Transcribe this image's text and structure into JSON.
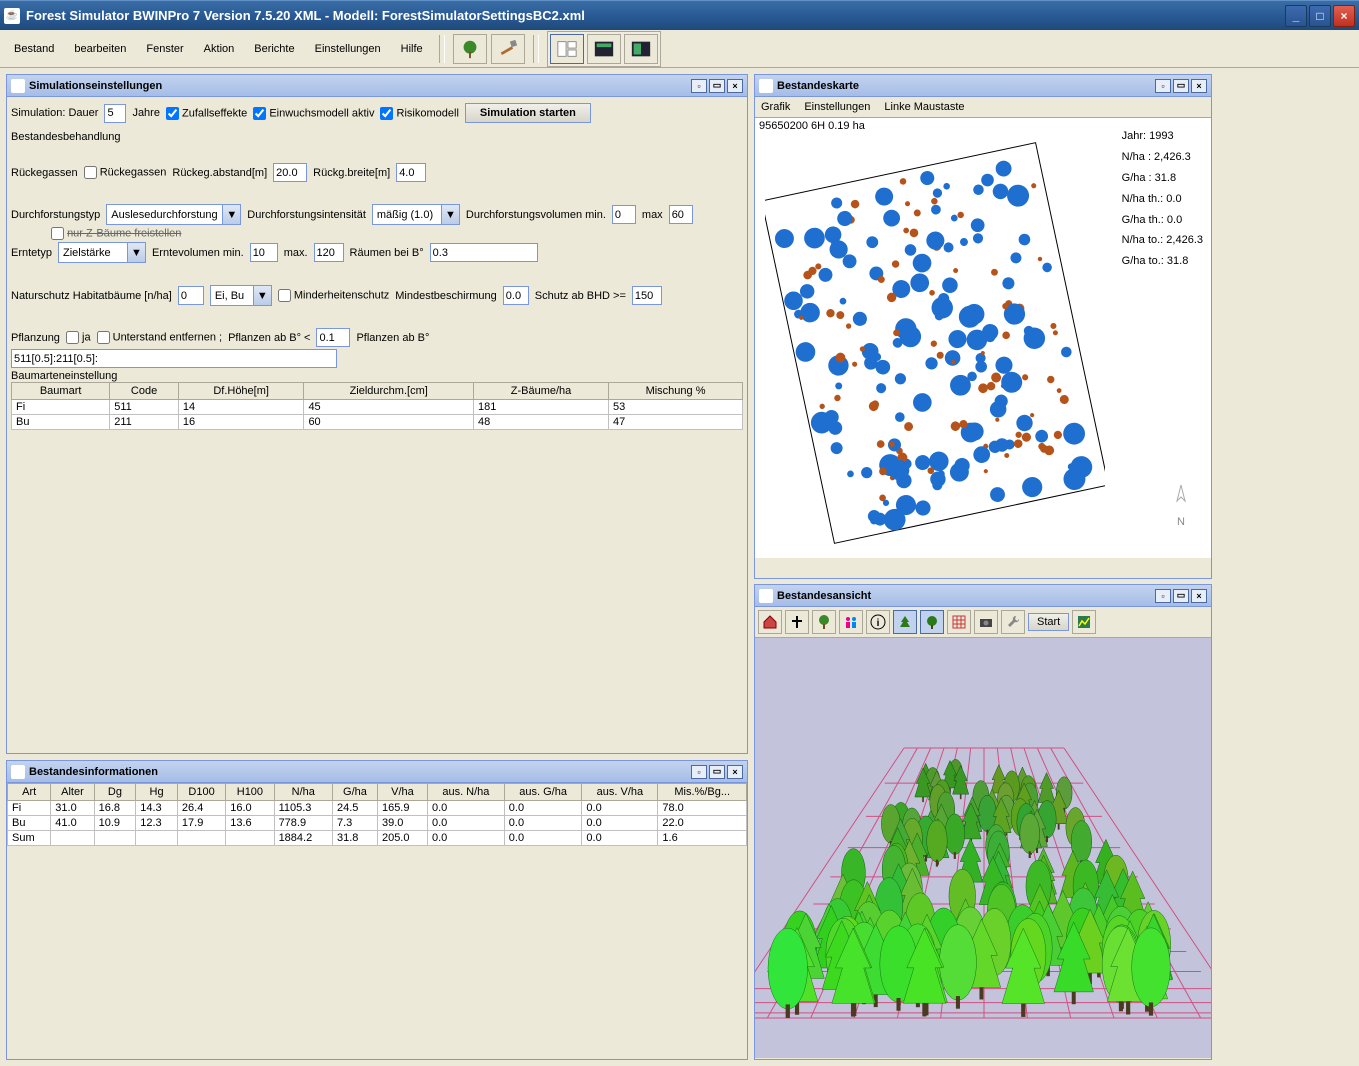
{
  "title": "Forest Simulator BWINPro 7 Version 7.5.20 XML - Modell: ForestSimulatorSettingsBC2.xml",
  "menu": {
    "bestand": "Bestand",
    "bearbeiten": "bearbeiten",
    "fenster": "Fenster",
    "aktion": "Aktion",
    "berichte": "Berichte",
    "einstellungen": "Einstellungen",
    "hilfe": "Hilfe"
  },
  "panel_sim": {
    "title": "Simulationseinstellungen",
    "sim_label": "Simulation: Dauer",
    "sim_years": "5",
    "jahre": "Jahre",
    "zufall": "Zufallseffekte",
    "einwuchs": "Einwuchsmodell aktiv",
    "risiko": "Risikomodell",
    "start": "Simulation starten",
    "behandlung": "Bestandesbehandlung",
    "ruckegassen": "Rückegassen",
    "ruckeg_abstand_lbl": "Rückeg.abstand[m]",
    "ruckeg_abstand": "20.0",
    "ruckeg_breite_lbl": "Rückg.breite[m]",
    "ruckeg_breite": "4.0",
    "df_typ_lbl": "Durchforstungstyp",
    "df_typ": "Auslesedurchforstung",
    "df_int_lbl": "Durchforstungsintensität",
    "df_int": "mäßig (1.0)",
    "df_vol_lbl": "Durchforstungsvolumen min.",
    "df_vol_min": "0",
    "df_vol_max_lbl": "max",
    "df_vol_max": "60",
    "freistellen": "nur Z-Bäume freistellen",
    "erntetyp_lbl": "Erntetyp",
    "erntetyp": "Zielstärke",
    "erntevol_lbl": "Erntevolumen min.",
    "erntevol_min": "10",
    "erntevol_max_lbl": "max.",
    "erntevol_max": "120",
    "raeumen_lbl": "Räumen bei B°",
    "raeumen": "0.3",
    "naturschutz_lbl": "Naturschutz Habitatbäume [n/ha]",
    "habitat": "0",
    "habitat_species": "Ei, Bu",
    "minderheit": "Minderheitenschutz",
    "mindestbeschirm_lbl": "Mindestbeschirmung",
    "mindestbeschirm": "0.0",
    "schutz_lbl": "Schutz ab BHD >=",
    "schutz": "150",
    "pflanzung_lbl": "Pflanzung",
    "pflanzung_ja": "ja",
    "unterstand": "Unterstand entfernen ;",
    "pflanzen_ab_lbl": "Pflanzen ab B°  <",
    "pflanzen_ab": "0.1",
    "pflanzen_ab2_lbl": "Pflanzen ab B°",
    "formula": "511[0.5]:211[0.5]:",
    "baumarten_lbl": "Baumarteneinstellung",
    "species_headers": [
      "Baumart",
      "Code",
      "Df.Höhe[m]",
      "Zieldurchm.[cm]",
      "Z-Bäume/ha",
      "Mischung %"
    ],
    "species_rows": [
      [
        "Fi",
        "511",
        "14",
        "45",
        "181",
        "53"
      ],
      [
        "Bu",
        "211",
        "16",
        "60",
        "48",
        "47"
      ]
    ]
  },
  "panel_info": {
    "title": "Bestandesinformationen",
    "headers": [
      "Art",
      "Alter",
      "Dg",
      "Hg",
      "D100",
      "H100",
      "N/ha",
      "G/ha",
      "V/ha",
      "aus. N/ha",
      "aus. G/ha",
      "aus. V/ha",
      "Mis.%/Bg..."
    ],
    "rows": [
      [
        "Fi",
        "31.0",
        "16.8",
        "14.3",
        "26.4",
        "16.0",
        "1105.3",
        "24.5",
        "165.9",
        "0.0",
        "0.0",
        "0.0",
        "78.0"
      ],
      [
        "Bu",
        "41.0",
        "10.9",
        "12.3",
        "17.9",
        "13.6",
        "778.9",
        "7.3",
        "39.0",
        "0.0",
        "0.0",
        "0.0",
        "22.0"
      ],
      [
        "Sum",
        "",
        "",
        "",
        "",
        "",
        "1884.2",
        "31.8",
        "205.0",
        "0.0",
        "0.0",
        "0.0",
        "1.6"
      ]
    ]
  },
  "panel_map": {
    "title": "Bestandeskarte",
    "menu": {
      "grafik": "Grafik",
      "einst": "Einstellungen",
      "maus": "Linke Maustaste"
    },
    "header": "95650200 6H  0.19 ha",
    "stats": {
      "jahr": "Jahr: 1993",
      "nha": "N/ha   : 2,426.3",
      "gha": "G/ha   : 31.8",
      "nhath": "N/ha th.: 0.0",
      "ghath": "G/ha th.: 0.0",
      "nhato": "N/ha to.: 2,426.3",
      "ghato": "G/ha to.: 31.8"
    }
  },
  "panel_view": {
    "title": "Bestandesansicht",
    "start": "Start"
  }
}
